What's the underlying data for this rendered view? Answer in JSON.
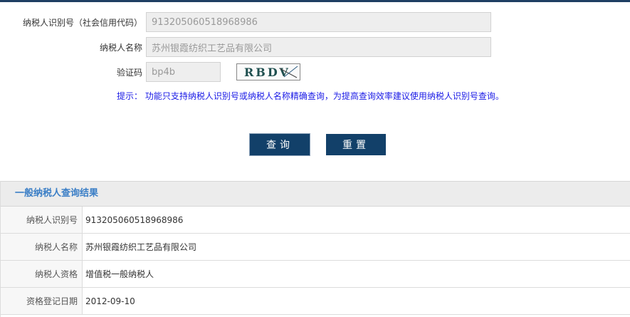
{
  "form": {
    "taxpayer_id_label": "纳税人识别号（社会信用代码）",
    "taxpayer_id_value": "913205060518968986",
    "taxpayer_name_label": "纳税人名称",
    "taxpayer_name_value": "苏州银霞纺织工艺品有限公司",
    "captcha_label": "验证码",
    "captcha_value": "bp4b",
    "captcha_image_text": "RBDV",
    "tip_text": "提示： 功能只支持纳税人识别号或纳税人名称精确查询，为提高查询效率建议使用纳税人识别号查询。"
  },
  "buttons": {
    "query_label": "查询",
    "reset_label": "重置"
  },
  "results": {
    "title": "一般纳税人查询结果",
    "rows": [
      {
        "key": "纳税人识别号",
        "value": "913205060518968986"
      },
      {
        "key": "纳税人名称",
        "value": "苏州银霞纺织工艺品有限公司"
      },
      {
        "key": "纳税人资格",
        "value": "增值税一般纳税人"
      },
      {
        "key": "资格登记日期",
        "value": "2012-09-10"
      }
    ]
  },
  "colors": {
    "header_bar": "#1f3f63",
    "button": "#124069",
    "tip": "#1a1ae6",
    "result_title": "#3a7ec6"
  }
}
